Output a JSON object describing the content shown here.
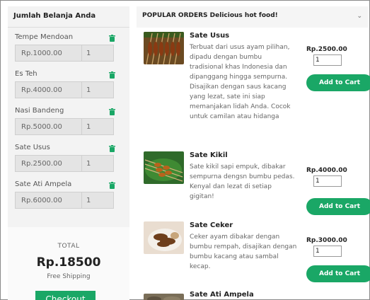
{
  "cart": {
    "title": "Jumlah Belanja Anda",
    "items": [
      {
        "name": "Tempe Mendoan",
        "price": "Rp.1000.00",
        "qty": "1"
      },
      {
        "name": "Es Teh",
        "price": "Rp.4000.00",
        "qty": "1"
      },
      {
        "name": "Nasi Bandeng",
        "price": "Rp.5000.00",
        "qty": "1"
      },
      {
        "name": "Sate Usus",
        "price": "Rp.2500.00",
        "qty": "1"
      },
      {
        "name": "Sate Ati Ampela",
        "price": "Rp.6000.00",
        "qty": "1"
      }
    ],
    "total_label": "TOTAL",
    "total_amount": "Rp.18500",
    "shipping": "Free Shipping",
    "checkout_label": "Checkout"
  },
  "orders": {
    "title": "POPULAR ORDERS Delicious hot food!",
    "products": [
      {
        "name": "Sate Usus",
        "description": "Terbuat dari usus ayam pilihan, dipadu dengan bumbu tradisional khas Indonesia dan dipanggang hingga sempurna. Disajikan dengan saus kacang yang lezat, sate ini siap memanjakan lidah Anda. Cocok untuk camilan atau hidanga",
        "price": "Rp.2500.00",
        "qty": "1",
        "button": "Add to Cart"
      },
      {
        "name": "Sate Kikil",
        "description": "Sate kikil sapi empuk, dibakar sempurna dengsn bumbu pedas. Kenyal dan lezat di setiap gigitan!",
        "price": "Rp.4000.00",
        "qty": "1",
        "button": "Add to Cart"
      },
      {
        "name": "Sate Ceker",
        "description": "Ceker ayam dibakar dengan bumbu rempah, disajikan dengan bumbu kacang atau sambal kecap.",
        "price": "Rp.3000.00",
        "qty": "1",
        "button": "Add to Cart"
      },
      {
        "name": "Sate Ati Ampela"
      }
    ]
  },
  "colors": {
    "accent": "#1aa766",
    "panel_bg": "#f3f3f3"
  },
  "icons": {
    "trash": "trash-icon",
    "chevron": "chevron-down-icon"
  }
}
